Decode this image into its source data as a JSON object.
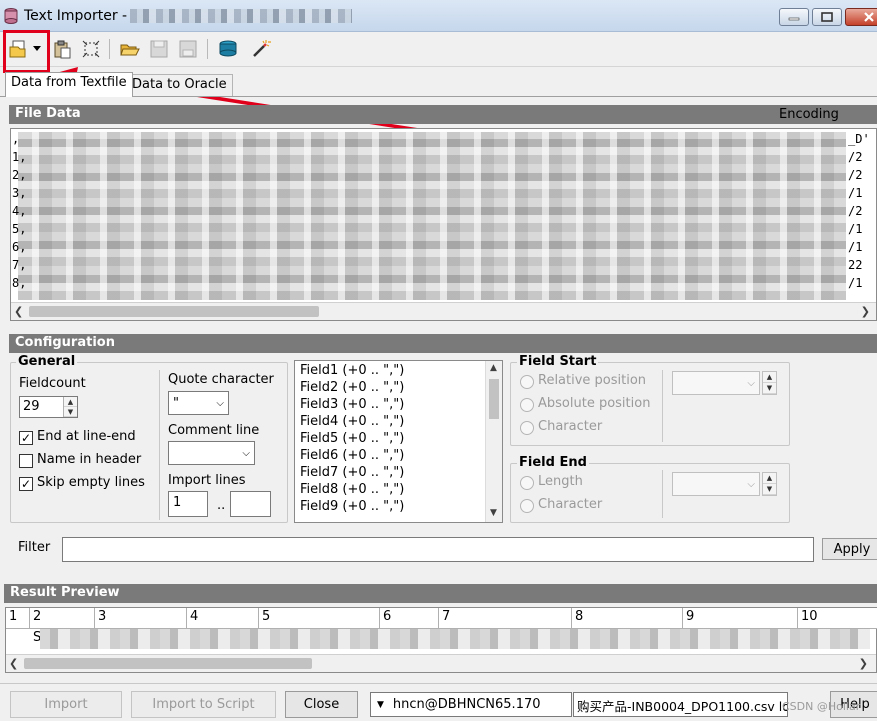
{
  "window": {
    "title": "Text Importer - ",
    "minimize_icon": "minimize-icon",
    "maximize_icon": "maximize-icon",
    "close_icon": "close-icon"
  },
  "toolbar": {
    "buttons": [
      "open-file-icon",
      "dropdown-arrow-icon",
      "paste-icon",
      "select-icon",
      "open-folder-icon",
      "save-icon",
      "save-as-icon",
      "database-icon",
      "magic-wand-icon"
    ]
  },
  "tabs": [
    {
      "label": "Data from Textfile",
      "active": true
    },
    {
      "label": "Data to Oracle",
      "active": false
    }
  ],
  "file_data": {
    "header": "File Data",
    "encoding_label": "Encoding",
    "line_prefixes": [
      ",",
      "1,",
      "2,",
      "3,",
      "4,",
      "5,",
      "6,",
      "7,",
      "8,"
    ],
    "line_suffixes": [
      "_D'",
      "/2",
      "/2",
      "/1",
      "/2",
      "/1",
      "/1",
      "22",
      "/1"
    ]
  },
  "configuration": {
    "header": "Configuration",
    "general": {
      "title": "General",
      "fieldcount_label": "Fieldcount",
      "fieldcount_value": "29",
      "end_at_line_end": {
        "label": "End at line-end",
        "checked": true
      },
      "name_in_header": {
        "label": "Name in header",
        "checked": false
      },
      "skip_empty_lines": {
        "label": "Skip empty lines",
        "checked": true
      },
      "quote_character_label": "Quote character",
      "quote_character_value": "\"",
      "comment_line_label": "Comment line",
      "comment_line_value": "",
      "import_lines_label": "Import lines",
      "import_lines_from": "1",
      "import_lines_separator": "..",
      "import_lines_to": ""
    },
    "fields": [
      "Field1  (+0 .. \",\")",
      "Field2  (+0 .. \",\")",
      "Field3  (+0 .. \",\")",
      "Field4  (+0 .. \",\")",
      "Field5  (+0 .. \",\")",
      "Field6  (+0 .. \",\")",
      "Field7  (+0 .. \",\")",
      "Field8  (+0 .. \",\")",
      "Field9  (+0 .. \",\")"
    ],
    "field_start": {
      "title": "Field Start",
      "options": [
        "Relative position",
        "Absolute position",
        "Character"
      ]
    },
    "field_end": {
      "title": "Field End",
      "options": [
        "Length",
        "Character"
      ]
    },
    "filter_label": "Filter",
    "filter_value": "",
    "apply_label": "Apply"
  },
  "result_preview": {
    "header": "Result Preview",
    "columns": [
      "1",
      "2",
      "3",
      "4",
      "5",
      "6",
      "7",
      "8",
      "9",
      "10"
    ],
    "first_cell": "S"
  },
  "bottom": {
    "import_label": "Import",
    "import_to_script_label": "Import to Script",
    "close_label": "Close",
    "connection": "hncn@DBHNCN65.170",
    "filename": "购买产品-INB0004_DPO1100.csv lo",
    "help_label": "Help",
    "watermark": "CSDN @Hollar"
  },
  "colors": {
    "highlight": "#e0001b",
    "panel_header": "#7a7a7a",
    "titlebar": "#c6d7ec"
  }
}
